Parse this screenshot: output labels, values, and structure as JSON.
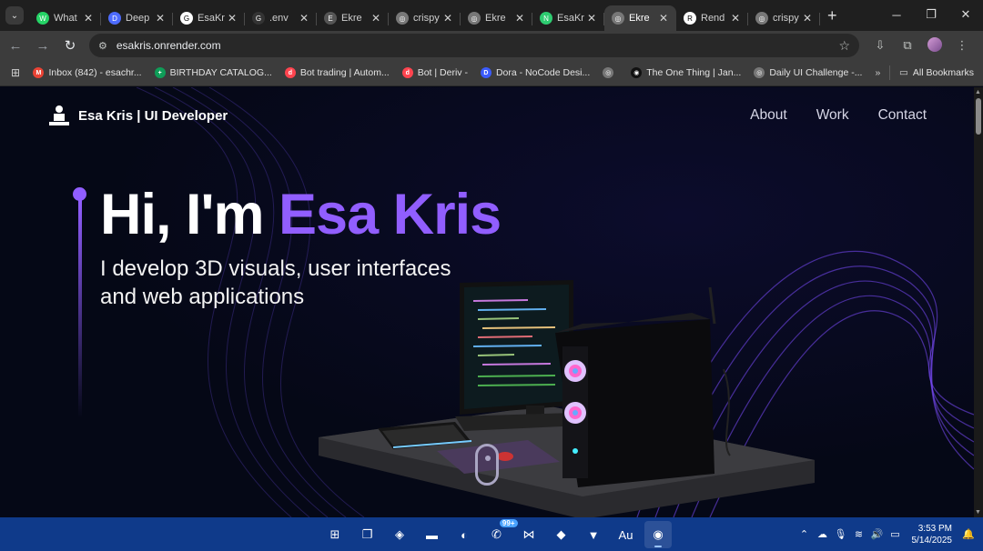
{
  "browser": {
    "tabs": [
      {
        "label": "What",
        "color": "#25d366",
        "glyph": "W"
      },
      {
        "label": "Deep",
        "color": "#4d6bfe",
        "glyph": "D"
      },
      {
        "label": "EsaKr",
        "color": "#ffffff",
        "glyph": "G"
      },
      {
        "label": ".env",
        "color": "#333333",
        "glyph": "G"
      },
      {
        "label": "Ekre",
        "color": "#555555",
        "glyph": "E"
      },
      {
        "label": "crispy",
        "color": "#777777",
        "glyph": "◎"
      },
      {
        "label": "Ekre",
        "color": "#777777",
        "glyph": "◎"
      },
      {
        "label": "EsaKr",
        "color": "#2ecc71",
        "glyph": "N"
      },
      {
        "label": "Ekre",
        "color": "#777777",
        "glyph": "◎"
      },
      {
        "label": "Rend",
        "color": "#ffffff",
        "glyph": "R"
      },
      {
        "label": "crispy",
        "color": "#777777",
        "glyph": "◎"
      }
    ],
    "active_tab_index": 8,
    "url": "esakris.onrender.com",
    "bookmarks": [
      {
        "label": "Inbox (842) - esachr...",
        "color": "#ea4335",
        "glyph": "M"
      },
      {
        "label": "BIRTHDAY CATALOG...",
        "color": "#0f9d58",
        "glyph": "+"
      },
      {
        "label": "Bot trading | Autom...",
        "color": "#ff444f",
        "glyph": "d"
      },
      {
        "label": "Bot | Deriv -",
        "color": "#ff444f",
        "glyph": "d"
      },
      {
        "label": "Dora - NoCode Desi...",
        "color": "#3b5bfd",
        "glyph": "D"
      },
      {
        "label": "",
        "color": "#777777",
        "glyph": "◎"
      },
      {
        "label": "The One Thing | Jan...",
        "color": "#111111",
        "glyph": "◉"
      },
      {
        "label": "Daily UI Challenge -...",
        "color": "#777777",
        "glyph": "◎"
      }
    ],
    "all_bookmarks": "All Bookmarks",
    "more_bookmarks": "»"
  },
  "site": {
    "logo_text": "Esa Kris  | UI Developer",
    "nav": [
      "About",
      "Work",
      "Contact"
    ],
    "hero": {
      "greeting": "Hi, I'm ",
      "name": "Esa Kris",
      "subtitle": "I develop 3D visuals, user interfaces and web applications"
    },
    "accent": "#915eff",
    "background": "#050816"
  },
  "taskbar": {
    "apps": [
      {
        "name": "start-icon",
        "glyph": "⊞"
      },
      {
        "name": "task-view-icon",
        "glyph": "❐"
      },
      {
        "name": "copilot-icon",
        "glyph": "◈"
      },
      {
        "name": "file-explorer-icon",
        "glyph": "▬"
      },
      {
        "name": "edge-icon",
        "glyph": "◐"
      },
      {
        "name": "whatsapp-icon",
        "glyph": "✆",
        "badge": "99+"
      },
      {
        "name": "vscode-icon",
        "glyph": "⋈"
      },
      {
        "name": "pgadmin-icon",
        "glyph": "◆"
      },
      {
        "name": "brave-icon",
        "glyph": "▼"
      },
      {
        "name": "audition-icon",
        "glyph": "Au"
      },
      {
        "name": "chrome-icon",
        "glyph": "◉",
        "active": true
      }
    ],
    "time": "3:53 PM",
    "date": "5/14/2025"
  }
}
